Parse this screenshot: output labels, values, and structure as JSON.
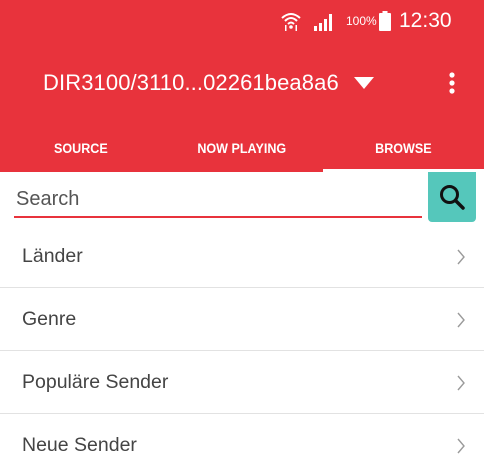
{
  "status_bar": {
    "battery_percent": "100%",
    "time": "12:30",
    "icons": [
      "wifi-icon",
      "signal-icon",
      "battery-icon"
    ]
  },
  "toolbar": {
    "device_title": "DIR3100/3110...02261bea8a6",
    "icons": [
      "dropdown-triangle-icon",
      "overflow-menu-icon"
    ]
  },
  "tabs": [
    {
      "label": "SOURCE",
      "active": false
    },
    {
      "label": "NOW PLAYING",
      "active": false
    },
    {
      "label": "BROWSE",
      "active": true
    }
  ],
  "search": {
    "placeholder": "Search",
    "value": "",
    "icon": "search-icon"
  },
  "browse_list": [
    {
      "label": "Länder"
    },
    {
      "label": "Genre"
    },
    {
      "label": "Populäre Sender"
    },
    {
      "label": "Neue Sender"
    }
  ],
  "colors": {
    "primary": "#e8333c",
    "search_button": "#55c7bb",
    "text": "#444444",
    "divider": "#e2e2e2"
  }
}
